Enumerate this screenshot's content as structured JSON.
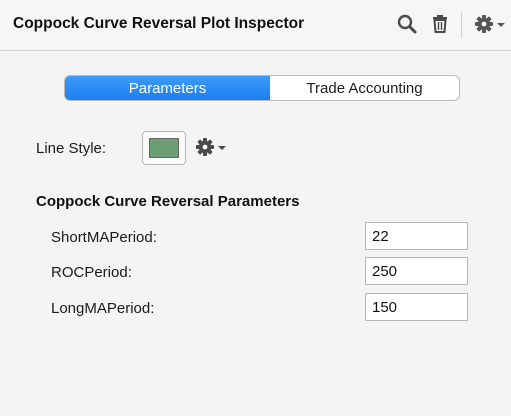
{
  "inspector": {
    "title": "Coppock Curve Reversal Plot Inspector",
    "toolbar_icons": [
      "search-icon",
      "trash-icon",
      "gear-icon",
      "chevron-down-icon"
    ]
  },
  "tabs": [
    {
      "label": "Parameters",
      "selected": true
    },
    {
      "label": "Trade Accounting",
      "selected": false
    }
  ],
  "line_style": {
    "label": "Line Style:",
    "color": "#6c9e73"
  },
  "parameters_section": {
    "title": "Coppock Curve Reversal Parameters",
    "items": [
      {
        "label": "ShortMAPeriod:",
        "value": "22"
      },
      {
        "label": "ROCPeriod:",
        "value": "250"
      },
      {
        "label": "LongMAPeriod:",
        "value": "150"
      }
    ]
  },
  "colors": {
    "accent": "#1a7ff0",
    "panel_background": "#f4f4f4"
  }
}
